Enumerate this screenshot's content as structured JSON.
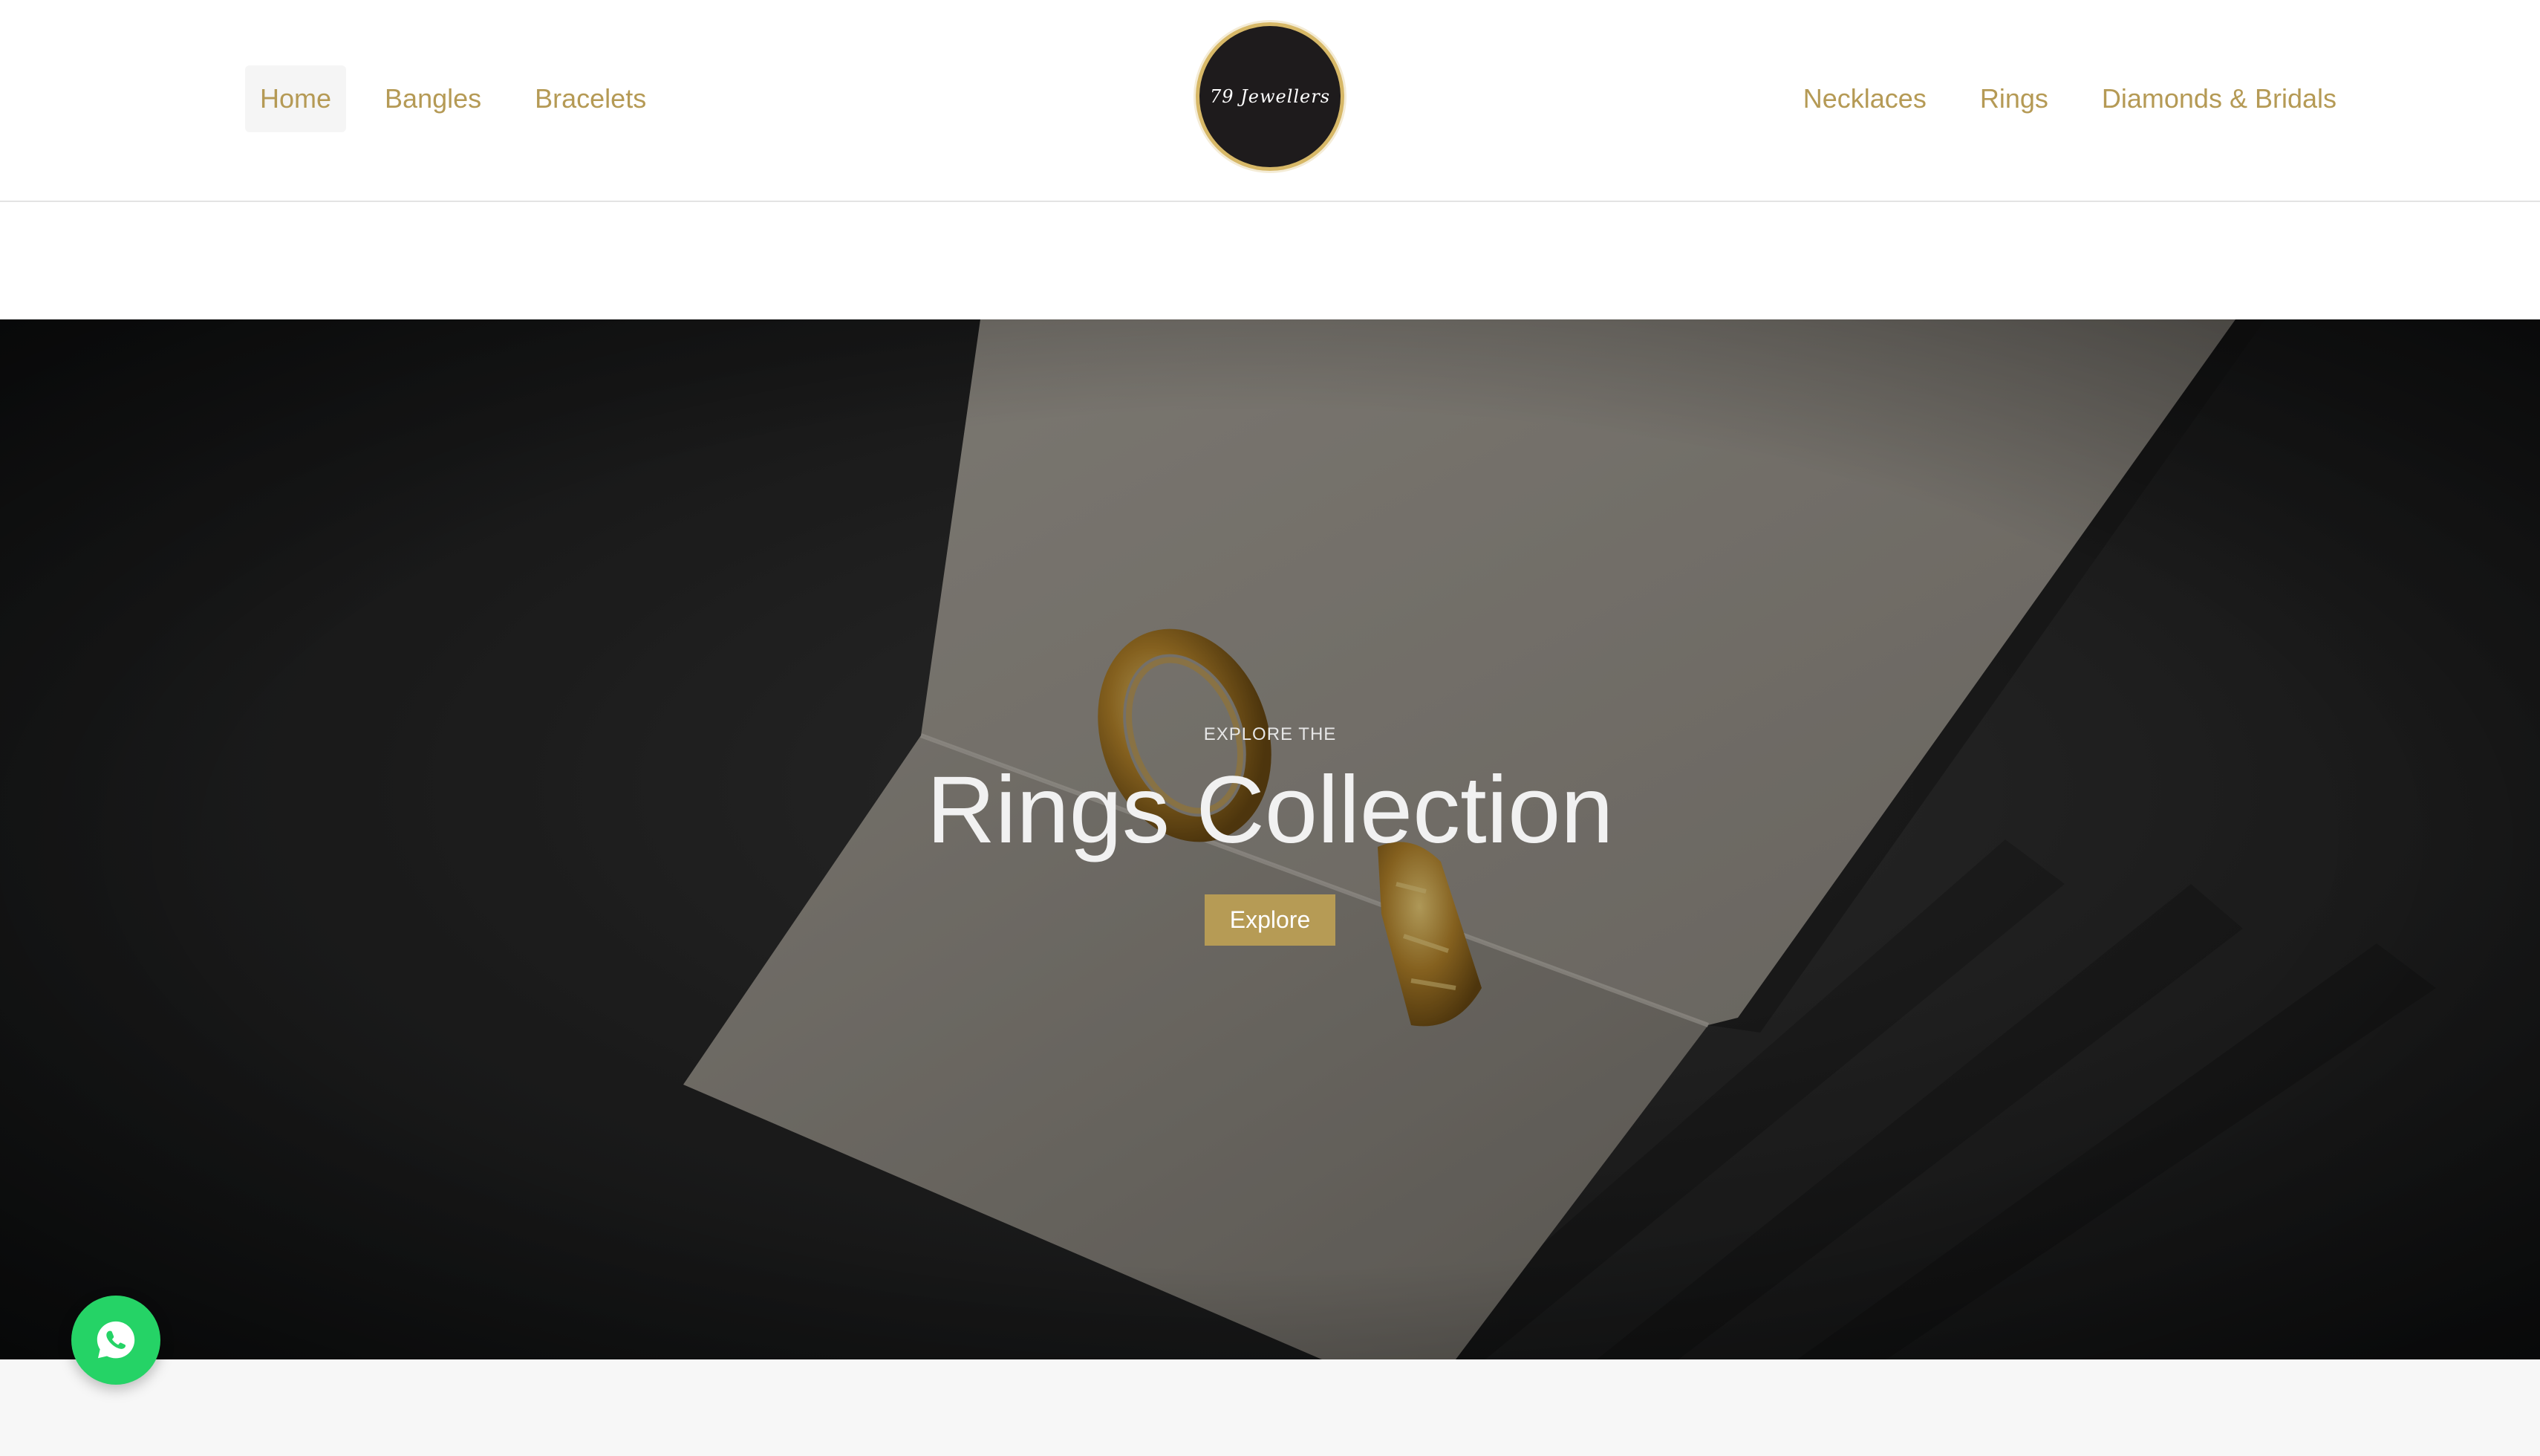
{
  "header": {
    "nav_left": [
      {
        "label": "Home",
        "active": true
      },
      {
        "label": "Bangles",
        "active": false
      },
      {
        "label": "Bracelets",
        "active": false
      }
    ],
    "nav_right": [
      {
        "label": "Necklaces",
        "active": false
      },
      {
        "label": "Rings",
        "active": false
      },
      {
        "label": "Diamonds & Bridals",
        "active": false
      }
    ],
    "logo_text": "79 Jewellers"
  },
  "hero": {
    "kicker": "EXPLORE THE",
    "title": "Rings Collection",
    "button_label": "Explore"
  },
  "floating": {
    "icon": "whatsapp-icon"
  },
  "colors": {
    "accent_gold": "#b59a55",
    "logo_bg": "#1e1b1c",
    "logo_ring": "#d7b867",
    "whatsapp_green": "#25d366",
    "bottom_band": "#f7f7f7"
  }
}
